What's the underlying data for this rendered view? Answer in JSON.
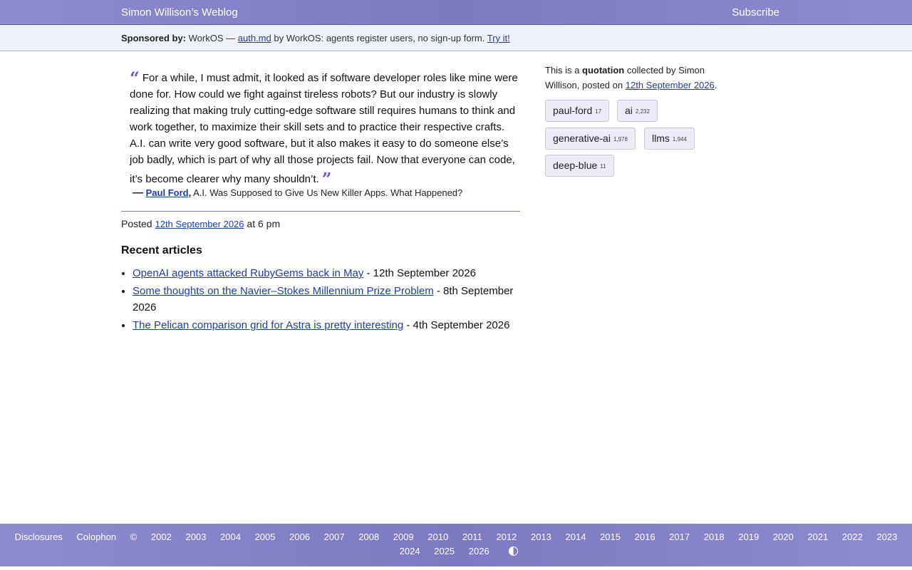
{
  "header": {
    "site_title": "Simon Willison’s Weblog",
    "subscribe": "Subscribe"
  },
  "sponsor": {
    "label": "Sponsored by:",
    "company": "WorkOS —",
    "link_text": "auth.md",
    "description": "by WorkOS: agents register users, no sign-up form.",
    "cta": "Try it!"
  },
  "quote": {
    "open_mark": "“",
    "close_mark": "”",
    "text": "For a while, I must admit, it looked as if software developer roles like mine were done for. How could we fight against tireless robots? But our industry is slowly realizing that making truly cutting-edge software still requires humans to think and work together, to maximize their skill sets and to practice their respective crafts. A.I. can write very good software, but it also makes it easy to do someone else’s job badly, which is part of why all those projects fail. Now that everyone can code, it’s become clearer why many shouldn’t.",
    "cite_dash": "—",
    "author": "Paul Ford",
    "source": "A.I. Was Supposed to Give Us New Killer Apps. What Happened?"
  },
  "posted": {
    "prefix": "Posted",
    "date": "12th September 2026",
    "time": "at 6 pm"
  },
  "recent": {
    "heading": "Recent articles",
    "items": [
      {
        "title": "OpenAI agents attacked RubyGems back in May",
        "date": "- 12th September 2026"
      },
      {
        "title": "Some thoughts on the Navier–Stokes Millennium Prize Problem",
        "date": "- 8th September 2026"
      },
      {
        "title": "The Pelican comparison grid for Astra is pretty interesting",
        "date": "- 4th September 2026"
      }
    ]
  },
  "meta": {
    "prefix": "This is a",
    "type": "quotation",
    "by": "collected by Simon Willison, posted on",
    "date": "12th September 2026",
    "end": "."
  },
  "tags": [
    {
      "name": "paul-ford",
      "count": "17"
    },
    {
      "name": "ai",
      "count": "2,232"
    },
    {
      "name": "generative-ai",
      "count": "1,978"
    },
    {
      "name": "llms",
      "count": "1,944"
    },
    {
      "name": "deep-blue",
      "count": "11"
    }
  ],
  "footer": {
    "disclosures": "Disclosures",
    "colophon": "Colophon",
    "copyright": "©",
    "years": [
      "2002",
      "2003",
      "2004",
      "2005",
      "2006",
      "2007",
      "2008",
      "2009",
      "2010",
      "2011",
      "2012",
      "2013",
      "2014",
      "2015",
      "2016",
      "2017",
      "2018",
      "2019",
      "2020",
      "2021",
      "2022",
      "2023",
      "2024",
      "2025",
      "2026"
    ],
    "contrast_icon": "contrast-icon"
  },
  "colors": {
    "accent": "#7d79c2",
    "link": "#1b3cb8",
    "quote_mark": "#7357c9"
  }
}
